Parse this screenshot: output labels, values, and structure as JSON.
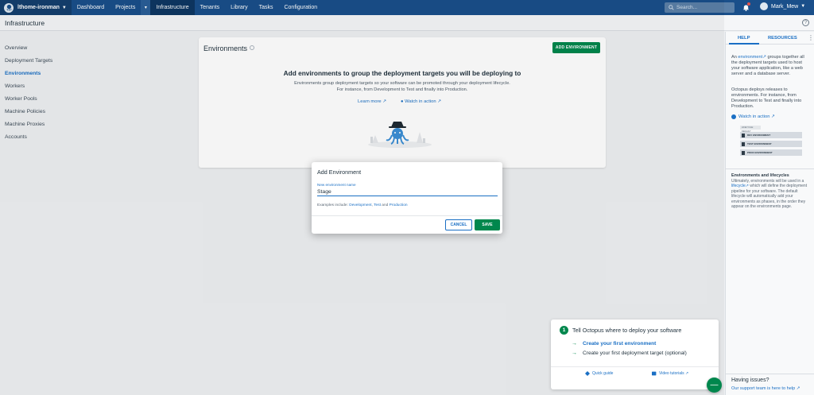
{
  "topnav": {
    "space_name": "lthome-ironman",
    "items": [
      "Dashboard",
      "Projects",
      "Infrastructure",
      "Tenants",
      "Library",
      "Tasks",
      "Configuration"
    ],
    "active": "Infrastructure",
    "search_placeholder": "Search...",
    "user_name": "Mark_Mew"
  },
  "page": {
    "title": "Infrastructure",
    "help_glyph": "?"
  },
  "sidebar": {
    "items": [
      {
        "label": "Overview"
      },
      {
        "label": "Deployment Targets"
      },
      {
        "label": "Environments"
      },
      {
        "label": "Workers"
      },
      {
        "label": "Worker Pools"
      },
      {
        "label": "Machine Policies"
      },
      {
        "label": "Machine Proxies"
      },
      {
        "label": "Accounts"
      }
    ],
    "active": "Environments"
  },
  "card": {
    "title": "Environments",
    "add_button": "ADD ENVIRONMENT",
    "heading": "Add environments to group the deployment targets you will be deploying to",
    "desc_line1": "Environments group deployment targets so your software can be promoted through your deployment lifecycle.",
    "desc_line2": "For instance, from Development to Test and finally into Production.",
    "learn_more": "Learn more",
    "watch": "Watch in action"
  },
  "help": {
    "tab_help": "HELP",
    "tab_resources": "RESOURCES",
    "para1_a": "An",
    "para1_link": "environment",
    "para1_b": "groups together all the deployment targets used to host your software application, like a web server and a database server.",
    "para2": "Octopus deploys releases to environments. For instance, from Development to Test and finally into Production.",
    "watch": "Watch in action",
    "diagram_head": "LIFECYCLE: DEFAULT",
    "diagram_rows": [
      "DEV ENVIRONMENT",
      "TEST ENVIRONMENT",
      "PROD ENVIRONMENT"
    ],
    "section_title": "Environments and lifecycles",
    "para3_a": "Ultimately, environments will be used in a",
    "para3_link": "lifecycle",
    "para3_b": "which will define the deployment pipeline for your software. The default lifecycle will automatically add your environments as phases, in the order they appear on the environments page.",
    "issues_title": "Having issues?",
    "issues_link": "Our support team is here to help"
  },
  "dialog": {
    "title": "Add Environment",
    "field_label": "New environment name",
    "field_value": "Stage",
    "examples_prefix": "Examples include:",
    "ex1": "Development",
    "ex2": "Test",
    "ex_and": "and",
    "ex3": "Production",
    "cancel": "CANCEL",
    "save": "SAVE"
  },
  "onboarding": {
    "step": "1",
    "title": "Tell Octopus where to deploy your software",
    "item1": "Create your first environment",
    "item2": "Create your first deployment target (optional)",
    "quick_guide": "Quick guide",
    "video_tutorials": "Video tutorials"
  },
  "fab_glyph": "—",
  "colors": {
    "nav": "#1a4f8a",
    "accent": "#1a6fc4",
    "success": "#00874d"
  }
}
